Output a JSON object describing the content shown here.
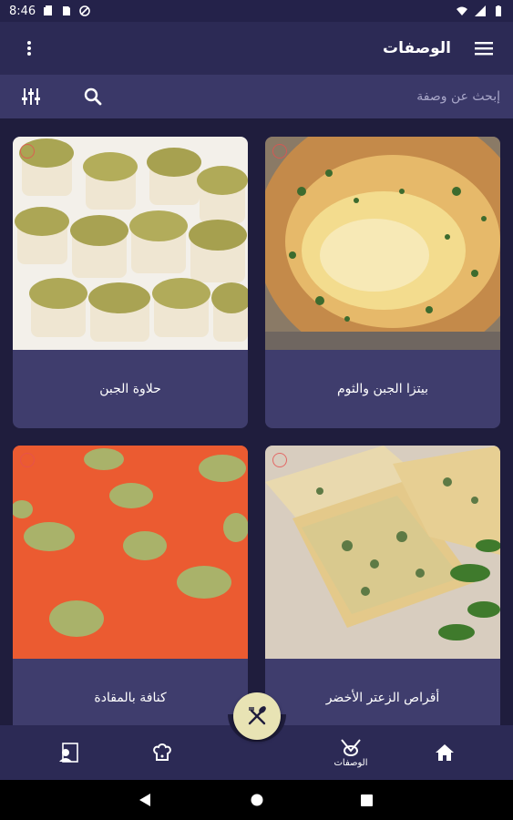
{
  "status_bar": {
    "time": "8:46"
  },
  "app_bar": {
    "title": "الوصفات"
  },
  "search": {
    "placeholder": "إبحث عن وصفة"
  },
  "recipes": [
    {
      "name": "بيتزا الجبن والثوم",
      "image": "cheese-garlic-pizza"
    },
    {
      "name": "حلاوة الجبن",
      "image": "cheese-halawa"
    },
    {
      "name": "أقراص الزعتر الأخضر",
      "image": "green-thyme-pastries"
    },
    {
      "name": "كنافة بالمقادة",
      "image": "kunafa"
    }
  ],
  "bottom_nav": {
    "items": [
      {
        "icon": "chef-profile-icon",
        "label": ""
      },
      {
        "icon": "chef-hat-icon",
        "label": ""
      },
      {
        "icon": "recipes-icon",
        "label": "الوصفات"
      },
      {
        "icon": "home-icon",
        "label": ""
      }
    ],
    "fab_icon": "fork-knife-icon"
  },
  "colors": {
    "background": "#1f1d3d",
    "app_bar": "#2c2a55",
    "search_bar": "#3a3868",
    "card": "#3f3d6d",
    "fab": "#e8e3b4"
  }
}
